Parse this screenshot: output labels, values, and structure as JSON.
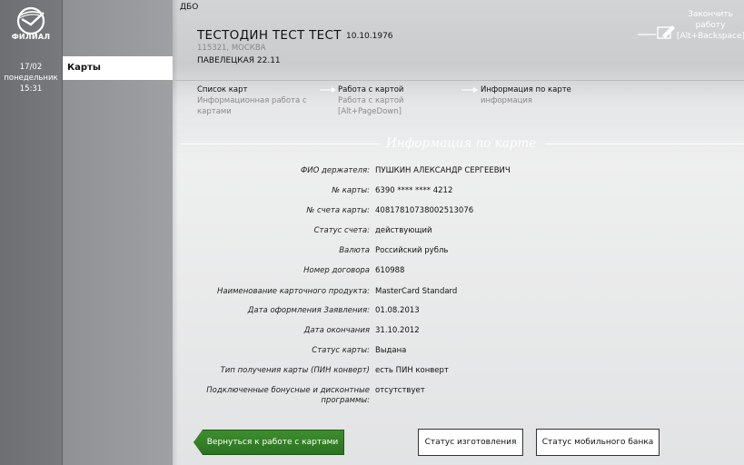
{
  "rail": {
    "logo_text": "ФИЛИАЛ",
    "date": "17/02",
    "weekday": "понедельник",
    "time": "15:31"
  },
  "menu": {
    "items": [
      {
        "label": "Карты"
      }
    ]
  },
  "header": {
    "system": "ДБО",
    "customer_name": "ТЕСТОДИН ТЕСТ ТЕСТ",
    "birth_date": "10.10.1976",
    "address_line1": "115321, МОСКВА",
    "address_line2": "ПАВЕЛЕЦКАЯ 22.11",
    "finish_label_1": "Закончить",
    "finish_label_2": "работу",
    "finish_shortcut": "[Alt+Backspace]"
  },
  "steps": [
    {
      "title": "Список карт",
      "sub1": "Информационная работа с",
      "sub2": "картами",
      "sub3": ""
    },
    {
      "title": "Работа с картой",
      "sub1": "Работа с картой",
      "sub2": "[Alt+PageDown]",
      "sub3": ""
    },
    {
      "title": "Информация по карте",
      "sub1": "информация",
      "sub2": "",
      "sub3": ""
    }
  ],
  "section_title": "Информация по карте",
  "fields": [
    {
      "label": "ФИО держателя:",
      "value": "ПУШКИН АЛЕКСАНДР СЕРГЕЕВИЧ"
    },
    {
      "label": "№ карты:",
      "value": "6390 **** **** 4212"
    },
    {
      "label": "№ счета карты:",
      "value": "40817810738002513076"
    },
    {
      "label": "Статус счета:",
      "value": "действующий"
    },
    {
      "label": "Валюта",
      "value": "Российский рубль"
    },
    {
      "label": "Номер договора",
      "value": "610988"
    },
    {
      "label": "Наименование карточного продукта:",
      "value": "MasterCard Standard"
    },
    {
      "label": "Дата оформления Заявления:",
      "value": "01.08.2013"
    },
    {
      "label": "Дата окончания",
      "value": "31.10.2012"
    },
    {
      "label": "Статус карты:",
      "value": "Выдана"
    },
    {
      "label": "Тип получения карты (ПИН конверт)",
      "value": "есть ПИН конверт"
    }
  ],
  "bonus_field": {
    "label_line1": "Подключенные бонусные и дисконтные",
    "label_line2": "программы:",
    "value": "отсутствует"
  },
  "buttons": {
    "back": "Вернуться к работе с картами",
    "manufacture_status": "Статус изготовления",
    "mobile_bank_status": "Статус мобильного банка"
  }
}
